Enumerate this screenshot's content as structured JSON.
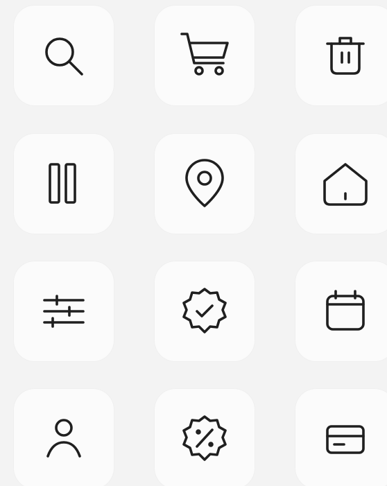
{
  "icons": [
    {
      "name": "search-icon"
    },
    {
      "name": "cart-icon"
    },
    {
      "name": "trash-icon"
    },
    {
      "name": "pause-icon"
    },
    {
      "name": "location-pin-icon"
    },
    {
      "name": "home-icon"
    },
    {
      "name": "sliders-icon"
    },
    {
      "name": "verified-badge-icon"
    },
    {
      "name": "calendar-icon"
    },
    {
      "name": "user-icon"
    },
    {
      "name": "discount-badge-icon"
    },
    {
      "name": "credit-card-icon"
    }
  ],
  "colors": {
    "page_background": "#f3f3f3",
    "tile_background": "#fbfbfb",
    "icon_stroke": "#1f1f1f"
  }
}
